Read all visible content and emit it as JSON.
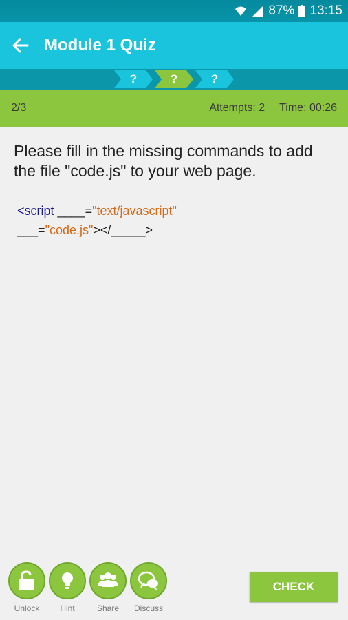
{
  "status_bar": {
    "battery": "87%",
    "time": "13:15"
  },
  "app_bar": {
    "title": "Module 1 Quiz"
  },
  "progress_steps": [
    "?",
    "?",
    "?"
  ],
  "info_bar": {
    "count": "2/3",
    "attempts": "Attempts: 2",
    "time": "Time: 00:26"
  },
  "question": "Please fill in the missing commands to add the file \"code.js\" to your web page.",
  "code": {
    "line1": {
      "open": "<script ",
      "blank": "____",
      "eq": "=",
      "value": "\"text/javascript\""
    },
    "line2": {
      "blank": "___",
      "eq": "=",
      "value": "\"code.js\"",
      "close_a": "></",
      "blank2": "_____",
      "close_b": ">"
    }
  },
  "toolbar": {
    "unlock": "Unlock",
    "hint": "Hint",
    "share": "Share",
    "discuss": "Discuss",
    "check": "CHECK"
  },
  "colors": {
    "primary": "#19c4dc",
    "accent": "#8cc63f"
  }
}
